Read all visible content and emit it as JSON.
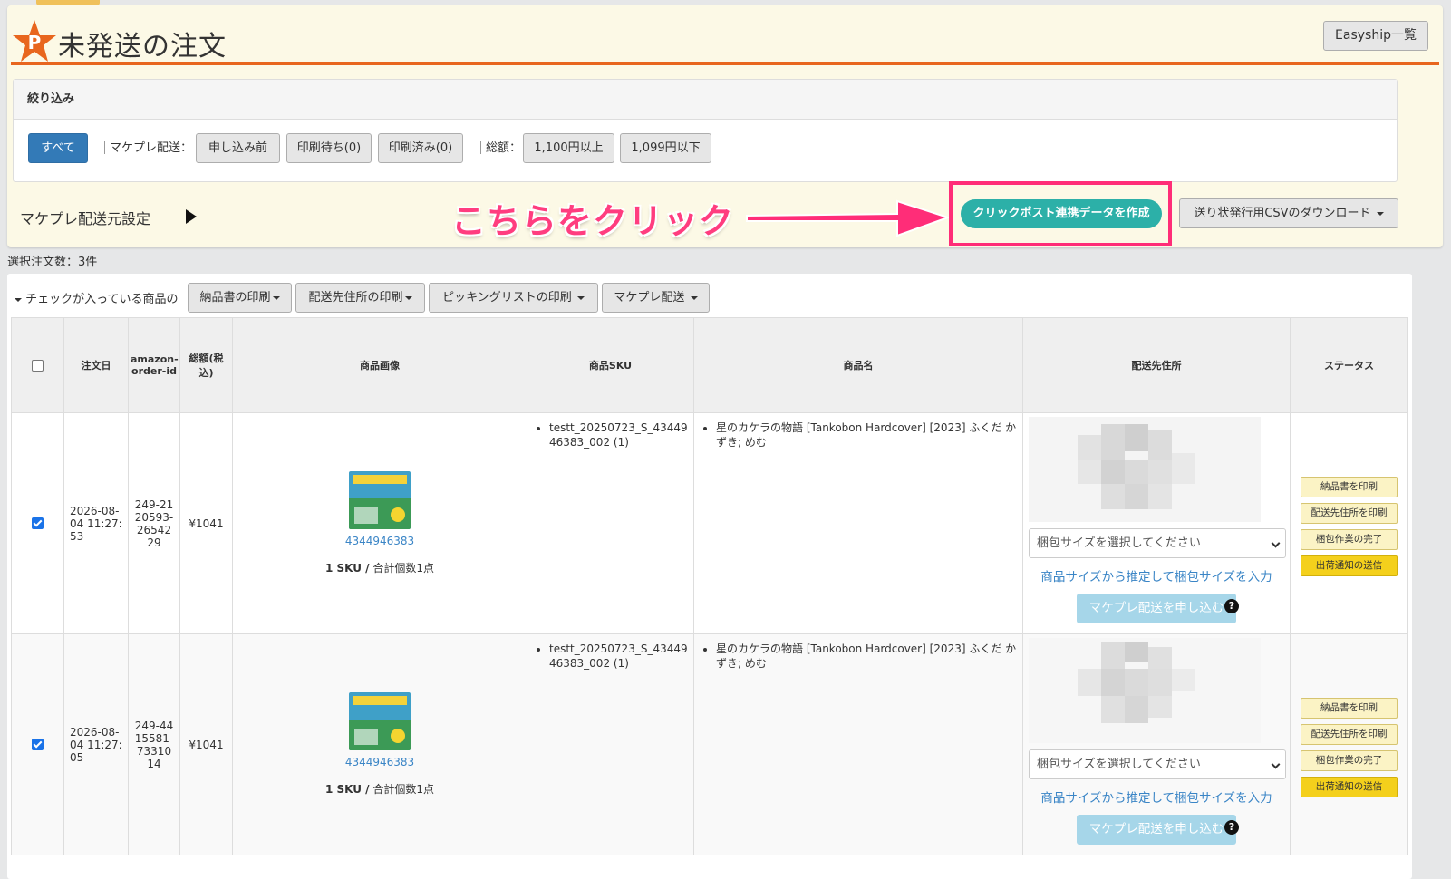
{
  "header": {
    "title": "未発送の注文",
    "easyship_button": "Easyship一覧"
  },
  "filter": {
    "heading": "絞り込み",
    "all_button": "すべて",
    "mcf_label": "マケプレ配送：",
    "mcf_buttons": [
      "申し込み前",
      "印刷待ち(0)",
      "印刷済み(0)"
    ],
    "total_label": "総額：",
    "total_buttons": [
      "1,100円以上",
      "1,099円以下"
    ]
  },
  "origin_settings": "マケプレ配送元設定",
  "annotation": "こちらをクリック",
  "clickpost_button": "クリックポスト連携データを作成",
  "csv_button": "送り状発行用CSVのダウンロード",
  "selected_count": "選択注文数：3件",
  "bulk": {
    "label": "チェックが入っている商品の",
    "buttons": [
      "納品書の印刷",
      "配送先住所の印刷",
      "ピッキングリストの印刷",
      "マケプレ配送"
    ]
  },
  "table": {
    "headers": {
      "date": "注文日",
      "order_id": "amazon-order-id",
      "total": "総額(税込)",
      "image": "商品画像",
      "sku": "商品SKU",
      "name": "商品名",
      "address": "配送先住所",
      "status": "ステータス"
    },
    "rows": [
      {
        "date": "2026-08-04 11:27:53",
        "order_id": "249-2120593-2654229",
        "total": "¥1041",
        "asin": "4344946383",
        "sku_count": "1 SKU /",
        "qty": "合計個数1点",
        "sku": "testt_20250723_S_4344946383_002 (1)",
        "name": "星のカケラの物語 [Tankobon Hardcover] [2023] ふくだ かずき; めむ",
        "size_placeholder": "梱包サイズを選択してください",
        "estimate_link": "商品サイズから推定して梱包サイズを入力",
        "apply_button": "マケプレ配送を申し込む"
      },
      {
        "date": "2026-08-04 11:27:05",
        "order_id": "249-4415581-7331014",
        "total": "¥1041",
        "asin": "4344946383",
        "sku_count": "1 SKU /",
        "qty": "合計個数1点",
        "sku": "testt_20250723_S_4344946383_002 (1)",
        "name": "星のカケラの物語 [Tankobon Hardcover] [2023] ふくだ かずき; めむ",
        "size_placeholder": "梱包サイズを選択してください",
        "estimate_link": "商品サイズから推定して梱包サイズを入力",
        "apply_button": "マケプレ配送を申し込む"
      }
    ],
    "status_buttons": [
      "納品書を印刷",
      "配送先住所を印刷",
      "梱包作業の完了",
      "出荷通知の送信"
    ]
  },
  "colors": {
    "primary": "#337ab7",
    "teal": "#2cb0a8",
    "annotation_pink": "#ff2d78",
    "title_rule": "#e8661e"
  }
}
